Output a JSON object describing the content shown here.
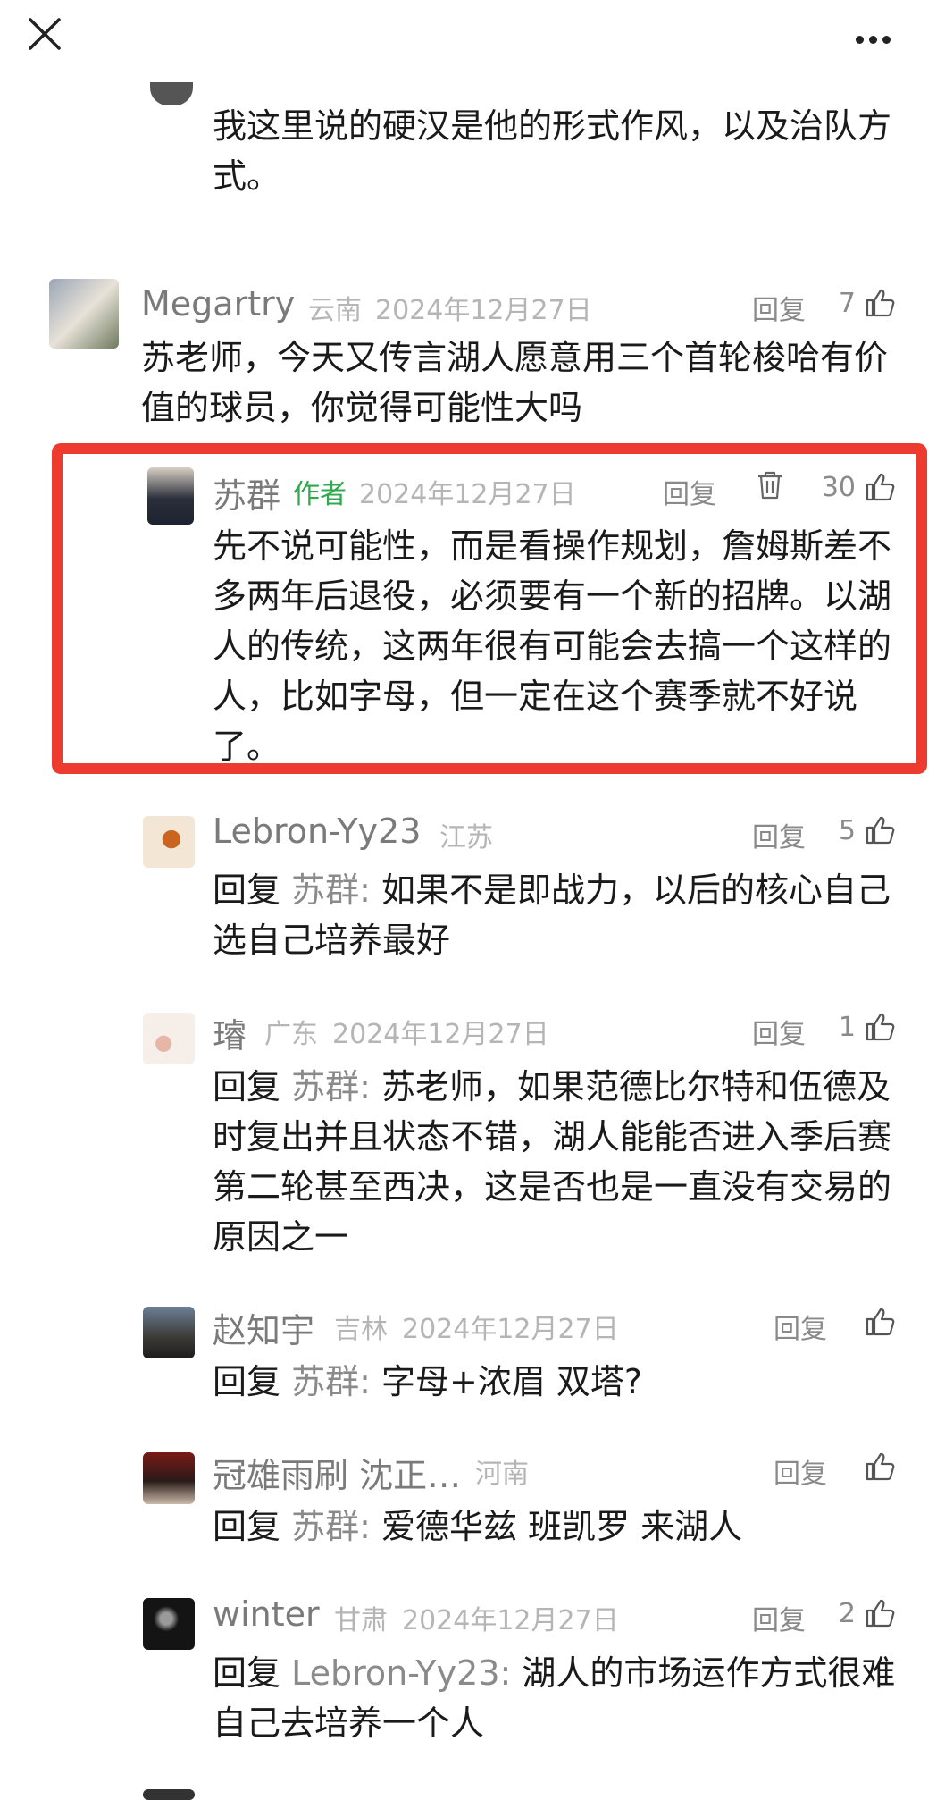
{
  "top_comment_tail": "我这里说的硬汉是他的形式作风，以及治队方式。",
  "comments": [
    {
      "name": "Megartry",
      "region": "云南",
      "date": "2024年12月27日",
      "reply_label": "回复",
      "likes": "7",
      "text": "苏老师，今天又传言湖人愿意用三个首轮梭哈有价值的球员，你觉得可能性大吗"
    }
  ],
  "author_reply": {
    "name": "苏群",
    "tag": "作者",
    "date": "2024年12月27日",
    "reply_label": "回复",
    "likes": "30",
    "text": "先不说可能性，而是看操作规划，詹姆斯差不多两年后退役，必须要有一个新的招牌。以湖人的传统，这两年很有可能会去搞一个这样的人，比如字母，但一定在这个赛季就不好说了。"
  },
  "replies": [
    {
      "name": "Lebron-Yy23",
      "region": "江苏",
      "date": "",
      "reply_label": "回复",
      "likes": "5",
      "prefix": "回复",
      "target": "苏群:",
      "text": "如果不是即战力，以后的核心自己选自己培养最好"
    },
    {
      "name": "璿",
      "region": "广东",
      "date": "2024年12月27日",
      "reply_label": "回复",
      "likes": "1",
      "prefix": "回复",
      "target": "苏群:",
      "text": "苏老师，如果范德比尔特和伍德及时复出并且状态不错，湖人能能否进入季后赛第二轮甚至西决，这是否也是一直没有交易的原因之一"
    },
    {
      "name": "赵知宇",
      "region": "吉林",
      "date": "2024年12月27日",
      "reply_label": "回复",
      "likes": "",
      "prefix": "回复",
      "target": "苏群:",
      "text": "字母+浓眉 双塔?"
    },
    {
      "name": "冠雄雨刷 沈正…",
      "region": "河南",
      "date": "",
      "reply_label": "回复",
      "likes": "",
      "prefix": "回复",
      "target": "苏群:",
      "text": "爱德华兹  班凯罗  来湖人"
    },
    {
      "name": "winter",
      "region": "甘肃",
      "date": "2024年12月27日",
      "reply_label": "回复",
      "likes": "2",
      "prefix": "回复",
      "target": "Lebron-Yy23:",
      "text": "湖人的市场运作方式很难自己去培养一个人"
    }
  ],
  "colors": {
    "highlight_border": "#ee3b2f",
    "author_tag": "#2fa84f",
    "meta_gray": "#b5b5b5"
  },
  "icons": [
    "close-icon",
    "more-icon",
    "like-icon",
    "trash-icon",
    "avatar"
  ]
}
